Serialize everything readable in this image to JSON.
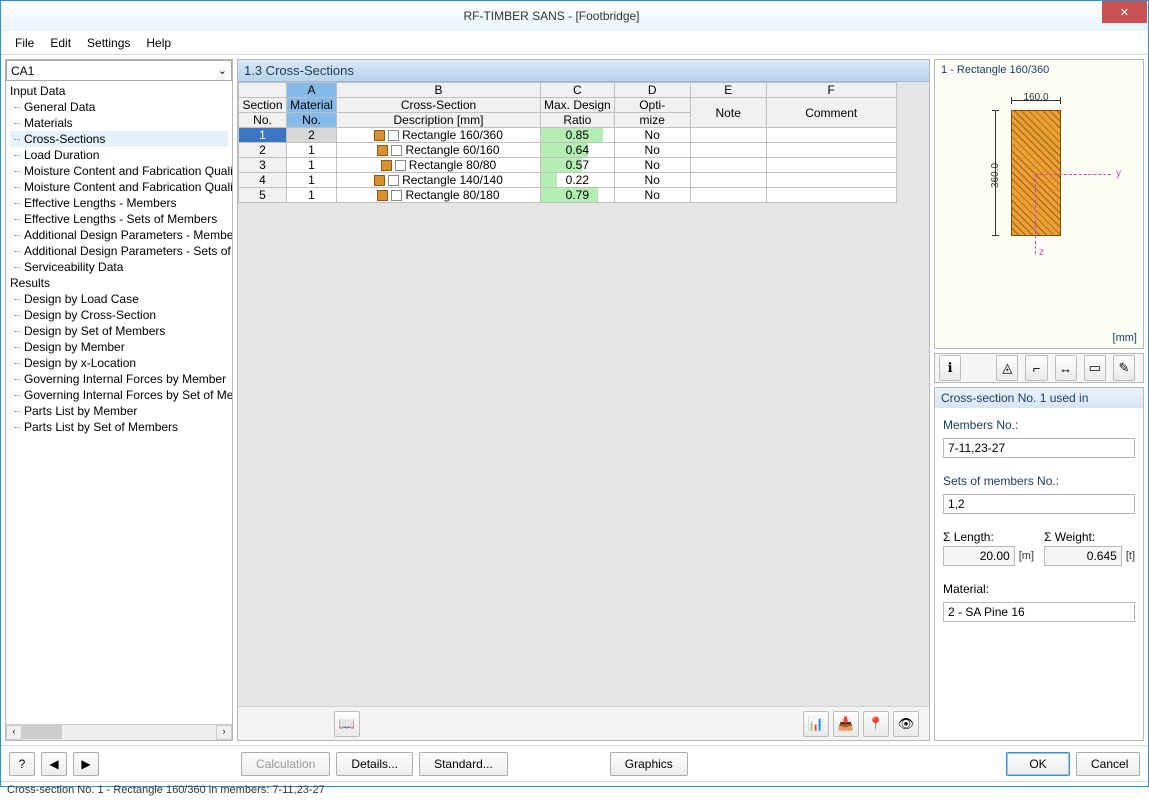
{
  "title": "RF-TIMBER SANS - [Footbridge]",
  "menu": {
    "file": "File",
    "edit": "Edit",
    "settings": "Settings",
    "help": "Help"
  },
  "combo": "CA1",
  "tree": {
    "input_label": "Input Data",
    "input": [
      "General Data",
      "Materials",
      "Cross-Sections",
      "Load Duration",
      "Moisture Content and Fabrication Quality",
      "Moisture Content and Fabrication Quality",
      "Effective Lengths - Members",
      "Effective Lengths - Sets of Members",
      "Additional Design Parameters - Members",
      "Additional Design Parameters - Sets of Members",
      "Serviceability Data"
    ],
    "results_label": "Results",
    "results": [
      "Design by Load Case",
      "Design by Cross-Section",
      "Design by Set of Members",
      "Design by Member",
      "Design by x-Location",
      "Governing Internal Forces by Member",
      "Governing Internal Forces by Set of Members",
      "Parts List by Member",
      "Parts List by Set of Members"
    ]
  },
  "panel_title": "1.3 Cross-Sections",
  "cols": {
    "letters": [
      "A",
      "B",
      "C",
      "D",
      "E",
      "F"
    ],
    "section": "Section",
    "no": "No.",
    "matno": "Material",
    "matno2": "No.",
    "desc": "Cross-Section",
    "desc2": "Description [mm]",
    "ratio": "Max. Design",
    "ratio2": "Ratio",
    "opti": "Opti-",
    "opti2": "mize",
    "note": "Note",
    "comment": "Comment"
  },
  "rows": [
    {
      "sec": "1",
      "mat": "2",
      "desc": "Rectangle 160/360",
      "ratio": "0.85",
      "opti": "No",
      "selected": true
    },
    {
      "sec": "2",
      "mat": "1",
      "desc": "Rectangle 60/160",
      "ratio": "0.64",
      "opti": "No"
    },
    {
      "sec": "3",
      "mat": "1",
      "desc": "Rectangle 80/80",
      "ratio": "0.57",
      "opti": "No"
    },
    {
      "sec": "4",
      "mat": "1",
      "desc": "Rectangle 140/140",
      "ratio": "0.22",
      "opti": "No"
    },
    {
      "sec": "5",
      "mat": "1",
      "desc": "Rectangle 80/180",
      "ratio": "0.79",
      "opti": "No"
    }
  ],
  "preview": {
    "title": "1 - Rectangle 160/360",
    "w": "160.0",
    "h": "360.0",
    "unit": "[mm]"
  },
  "info": {
    "title": "Cross-section No. 1 used in",
    "members_label": "Members No.:",
    "members": "7-11,23-27",
    "sets_label": "Sets of members No.:",
    "sets": "1,2",
    "sum_len_label": "Σ Length:",
    "sum_len": "20.00",
    "len_unit": "[m]",
    "sum_w_label": "Σ Weight:",
    "sum_w": "0.645",
    "w_unit": "[t]",
    "mat_label": "Material:",
    "mat": "2 - SA Pine 16"
  },
  "buttons": {
    "calc": "Calculation",
    "details": "Details...",
    "standard": "Standard...",
    "graphics": "Graphics",
    "ok": "OK",
    "cancel": "Cancel"
  },
  "status": "Cross-section No. 1 - Rectangle 160/360 in members: 7-11,23-27"
}
